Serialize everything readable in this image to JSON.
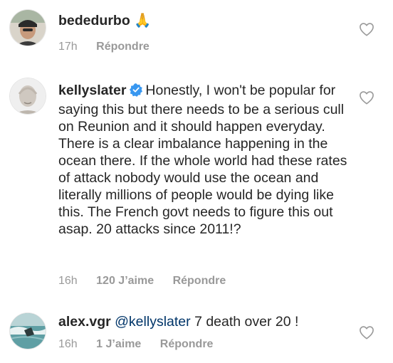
{
  "comments": [
    {
      "username": "bededurbo",
      "text": "",
      "emoji": "🙏",
      "time": "17h",
      "likes": "",
      "reply_label": "Répondre",
      "verified": false
    },
    {
      "username": "kellyslater",
      "text": "Honestly, I won't be popular for saying this but there needs to be a serious cull on Reunion and it should happen everyday. There is a clear imbalance happening in the ocean there. If the whole world had these rates of attack nobody would use the ocean and literally millions of people would be dying like this. The French govt needs to figure this out asap. 20 attacks since 2011!?",
      "time": "16h",
      "likes": "120 J’aime",
      "reply_label": "Répondre",
      "verified": true
    },
    {
      "username": "alex.vgr",
      "mention": "@kellyslater",
      "text": "7 death over 20 !",
      "time": "16h",
      "likes": "1 J’aime",
      "reply_label": "Répondre",
      "verified": false
    }
  ],
  "colors": {
    "text": "#262626",
    "meta": "#999999",
    "mention": "#003569",
    "verified": "#3897f0"
  },
  "icons": {
    "like": "heart-outline-icon",
    "verified": "verified-badge-icon"
  }
}
